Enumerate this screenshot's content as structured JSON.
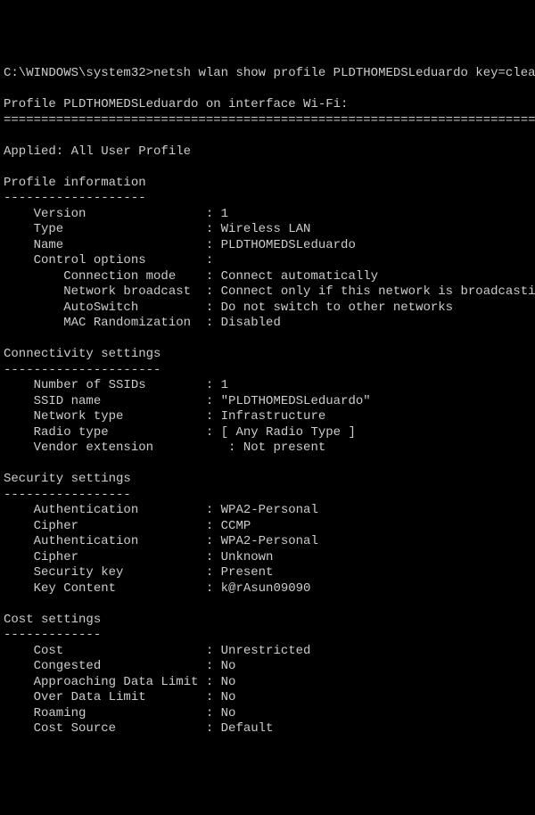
{
  "prompt_path": "C:\\WINDOWS\\system32>",
  "command": "netsh wlan show profile PLDTHOMEDSLeduardo key=clear",
  "blank": "",
  "profile_line": "Profile PLDTHOMEDSLeduardo on interface Wi-Fi:",
  "divider": "===========================================================================",
  "applied_line": "Applied: All User Profile",
  "s1_header": "Profile information",
  "s1_dash": "-------------------",
  "s1_l1": "    Version                : 1",
  "s1_l2": "    Type                   : Wireless LAN",
  "s1_l3": "    Name                   : PLDTHOMEDSLeduardo",
  "s1_l4": "    Control options        :",
  "s1_l5": "        Connection mode    : Connect automatically",
  "s1_l6": "        Network broadcast  : Connect only if this network is broadcasting",
  "s1_l7": "        AutoSwitch         : Do not switch to other networks",
  "s1_l8": "        MAC Randomization  : Disabled",
  "s2_header": "Connectivity settings",
  "s2_dash": "---------------------",
  "s2_l1": "    Number of SSIDs        : 1",
  "s2_l2": "    SSID name              : \"PLDTHOMEDSLeduardo\"",
  "s2_l3": "    Network type           : Infrastructure",
  "s2_l4": "    Radio type             : [ Any Radio Type ]",
  "s2_l5": "    Vendor extension          : Not present",
  "s3_header": "Security settings",
  "s3_dash": "-----------------",
  "s3_l1": "    Authentication         : WPA2-Personal",
  "s3_l2": "    Cipher                 : CCMP",
  "s3_l3": "    Authentication         : WPA2-Personal",
  "s3_l4": "    Cipher                 : Unknown",
  "s3_l5": "    Security key           : Present",
  "s3_l6": "    Key Content            : k@rAsun09090",
  "s4_header": "Cost settings",
  "s4_dash": "-------------",
  "s4_l1": "    Cost                   : Unrestricted",
  "s4_l2": "    Congested              : No",
  "s4_l3": "    Approaching Data Limit : No",
  "s4_l4": "    Over Data Limit        : No",
  "s4_l5": "    Roaming                : No",
  "s4_l6": "    Cost Source            : Default"
}
